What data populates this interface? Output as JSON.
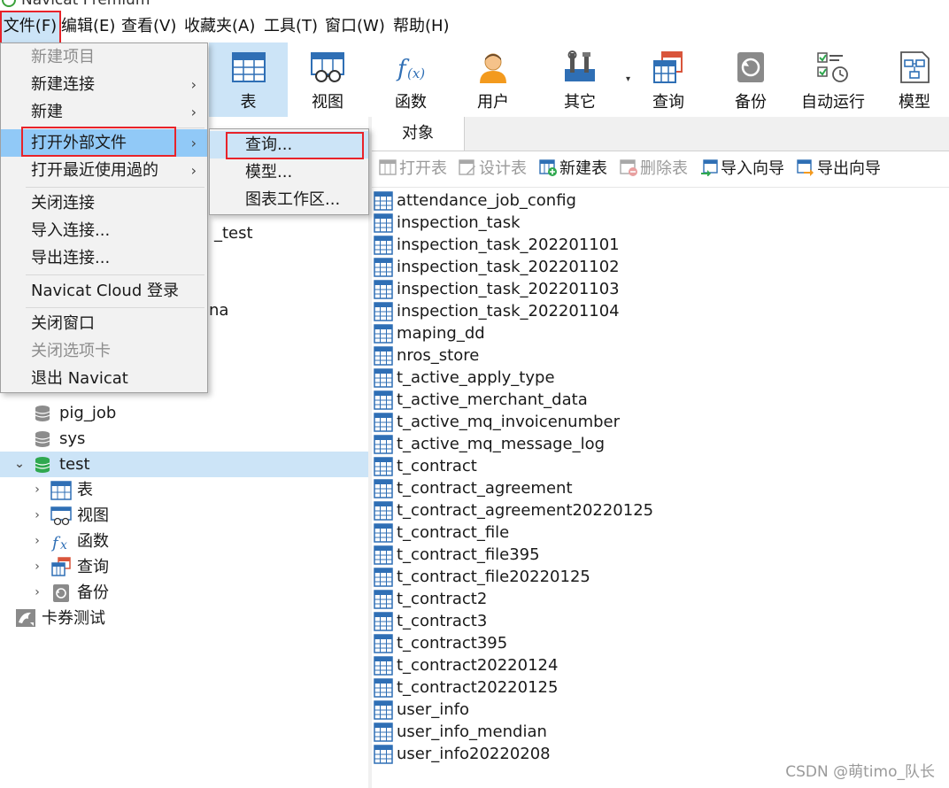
{
  "window": {
    "title": "Navicat Premium"
  },
  "menubar": {
    "items": [
      {
        "label": "文件(F)"
      },
      {
        "label": "编辑(E)"
      },
      {
        "label": "查看(V)"
      },
      {
        "label": "收藏夹(A)"
      },
      {
        "label": "工具(T)"
      },
      {
        "label": "窗口(W)"
      },
      {
        "label": "帮助(H)"
      }
    ]
  },
  "toolbar": {
    "items": [
      {
        "label": "表",
        "icon": "table-icon"
      },
      {
        "label": "视图",
        "icon": "view-icon"
      },
      {
        "label": "函数",
        "icon": "function-icon"
      },
      {
        "label": "用户",
        "icon": "user-icon"
      },
      {
        "label": "其它",
        "icon": "tools-icon"
      },
      {
        "label": "查询",
        "icon": "query-icon"
      },
      {
        "label": "备份",
        "icon": "backup-icon"
      },
      {
        "label": "自动运行",
        "icon": "schedule-icon"
      },
      {
        "label": "模型",
        "icon": "model-icon"
      }
    ]
  },
  "file_menu": {
    "items": [
      {
        "label": "新建项目",
        "disabled": true
      },
      {
        "label": "新建连接",
        "submenu": true
      },
      {
        "label": "新建",
        "submenu": true
      },
      {
        "label": "打开外部文件",
        "submenu": true,
        "highlighted": true
      },
      {
        "label": "打开最近使用過的",
        "submenu": true
      },
      {
        "label": "关闭连接"
      },
      {
        "label": "导入连接..."
      },
      {
        "label": "导出连接..."
      },
      {
        "label": "Navicat Cloud 登录"
      },
      {
        "label": "关闭窗口"
      },
      {
        "label": "关闭选项卡",
        "disabled": true
      },
      {
        "label": "退出 Navicat"
      }
    ],
    "submenu_arrow": "›"
  },
  "open_external_submenu": {
    "items": [
      {
        "label": "查询..."
      },
      {
        "label": "模型..."
      },
      {
        "label": "图表工作区..."
      }
    ]
  },
  "tree": {
    "partial_items": [
      {
        "label": "_test"
      },
      {
        "label": "na"
      }
    ],
    "databases": [
      {
        "label": "pig_job"
      },
      {
        "label": "sys"
      },
      {
        "label": "test",
        "expanded": true
      }
    ],
    "children": [
      {
        "label": "表",
        "icon": "table-icon"
      },
      {
        "label": "视图",
        "icon": "view-icon"
      },
      {
        "label": "函数",
        "icon": "function-icon"
      },
      {
        "label": "查询",
        "icon": "query-icon"
      },
      {
        "label": "备份",
        "icon": "backup-icon"
      }
    ],
    "connection": {
      "label": "卡券测试",
      "icon": "mysql-dolphin-icon"
    }
  },
  "objects_tab": {
    "label": "对象"
  },
  "object_toolbar": {
    "items": [
      {
        "label": "打开表",
        "disabled": true
      },
      {
        "label": "设计表",
        "disabled": true
      },
      {
        "label": "新建表",
        "disabled": false
      },
      {
        "label": "删除表",
        "disabled": true
      },
      {
        "label": "导入向导",
        "disabled": false
      },
      {
        "label": "导出向导",
        "disabled": false
      }
    ]
  },
  "tables": [
    "attendance_job_config",
    "inspection_task",
    "inspection_task_202201101",
    "inspection_task_202201102",
    "inspection_task_202201103",
    "inspection_task_202201104",
    "maping_dd",
    "nros_store",
    "t_active_apply_type",
    "t_active_merchant_data",
    "t_active_mq_invoicenumber",
    "t_active_mq_message_log",
    "t_contract",
    "t_contract_agreement",
    "t_contract_agreement20220125",
    "t_contract_file",
    "t_contract_file395",
    "t_contract_file20220125",
    "t_contract2",
    "t_contract3",
    "t_contract395",
    "t_contract20220124",
    "t_contract20220125",
    "user_info",
    "user_info_mendian",
    "user_info20220208"
  ],
  "watermark": "CSDN @萌timo_队长",
  "colors": {
    "selection": "#cce4f7",
    "menu_highlight": "#91c9f7",
    "annotation_red": "#e8232a",
    "db_green": "#2fa84f",
    "table_blue": "#2f6fb5"
  }
}
